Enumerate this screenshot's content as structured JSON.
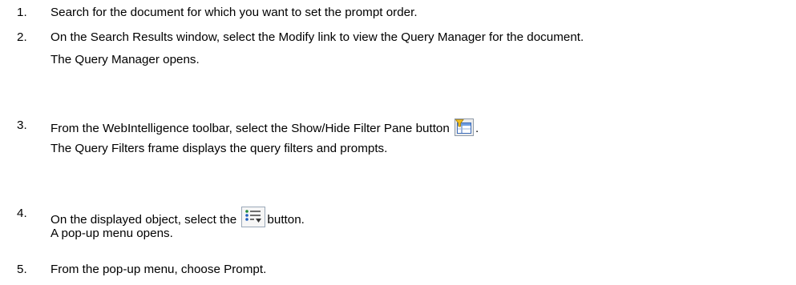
{
  "steps": [
    {
      "number": "1.",
      "text": "Search for the document for which you want to set the prompt order."
    },
    {
      "number": "2.",
      "text": "On the Search Results window, select the Modify link to view the Query Manager for the document.",
      "result": "The Query Manager opens."
    },
    {
      "number": "3.",
      "text_before": "From the WebIntelligence toolbar, select the Show/Hide Filter Pane button",
      "text_after": ".",
      "icon": "filter-pane-icon",
      "result": "The Query Filters frame displays the query filters and prompts."
    },
    {
      "number": "4.",
      "text_before": "On the displayed object, select the",
      "text_after": "button.",
      "icon": "list-menu-icon",
      "result": "A pop-up menu opens."
    },
    {
      "number": "5.",
      "text": "From the pop-up menu, choose Prompt."
    }
  ]
}
